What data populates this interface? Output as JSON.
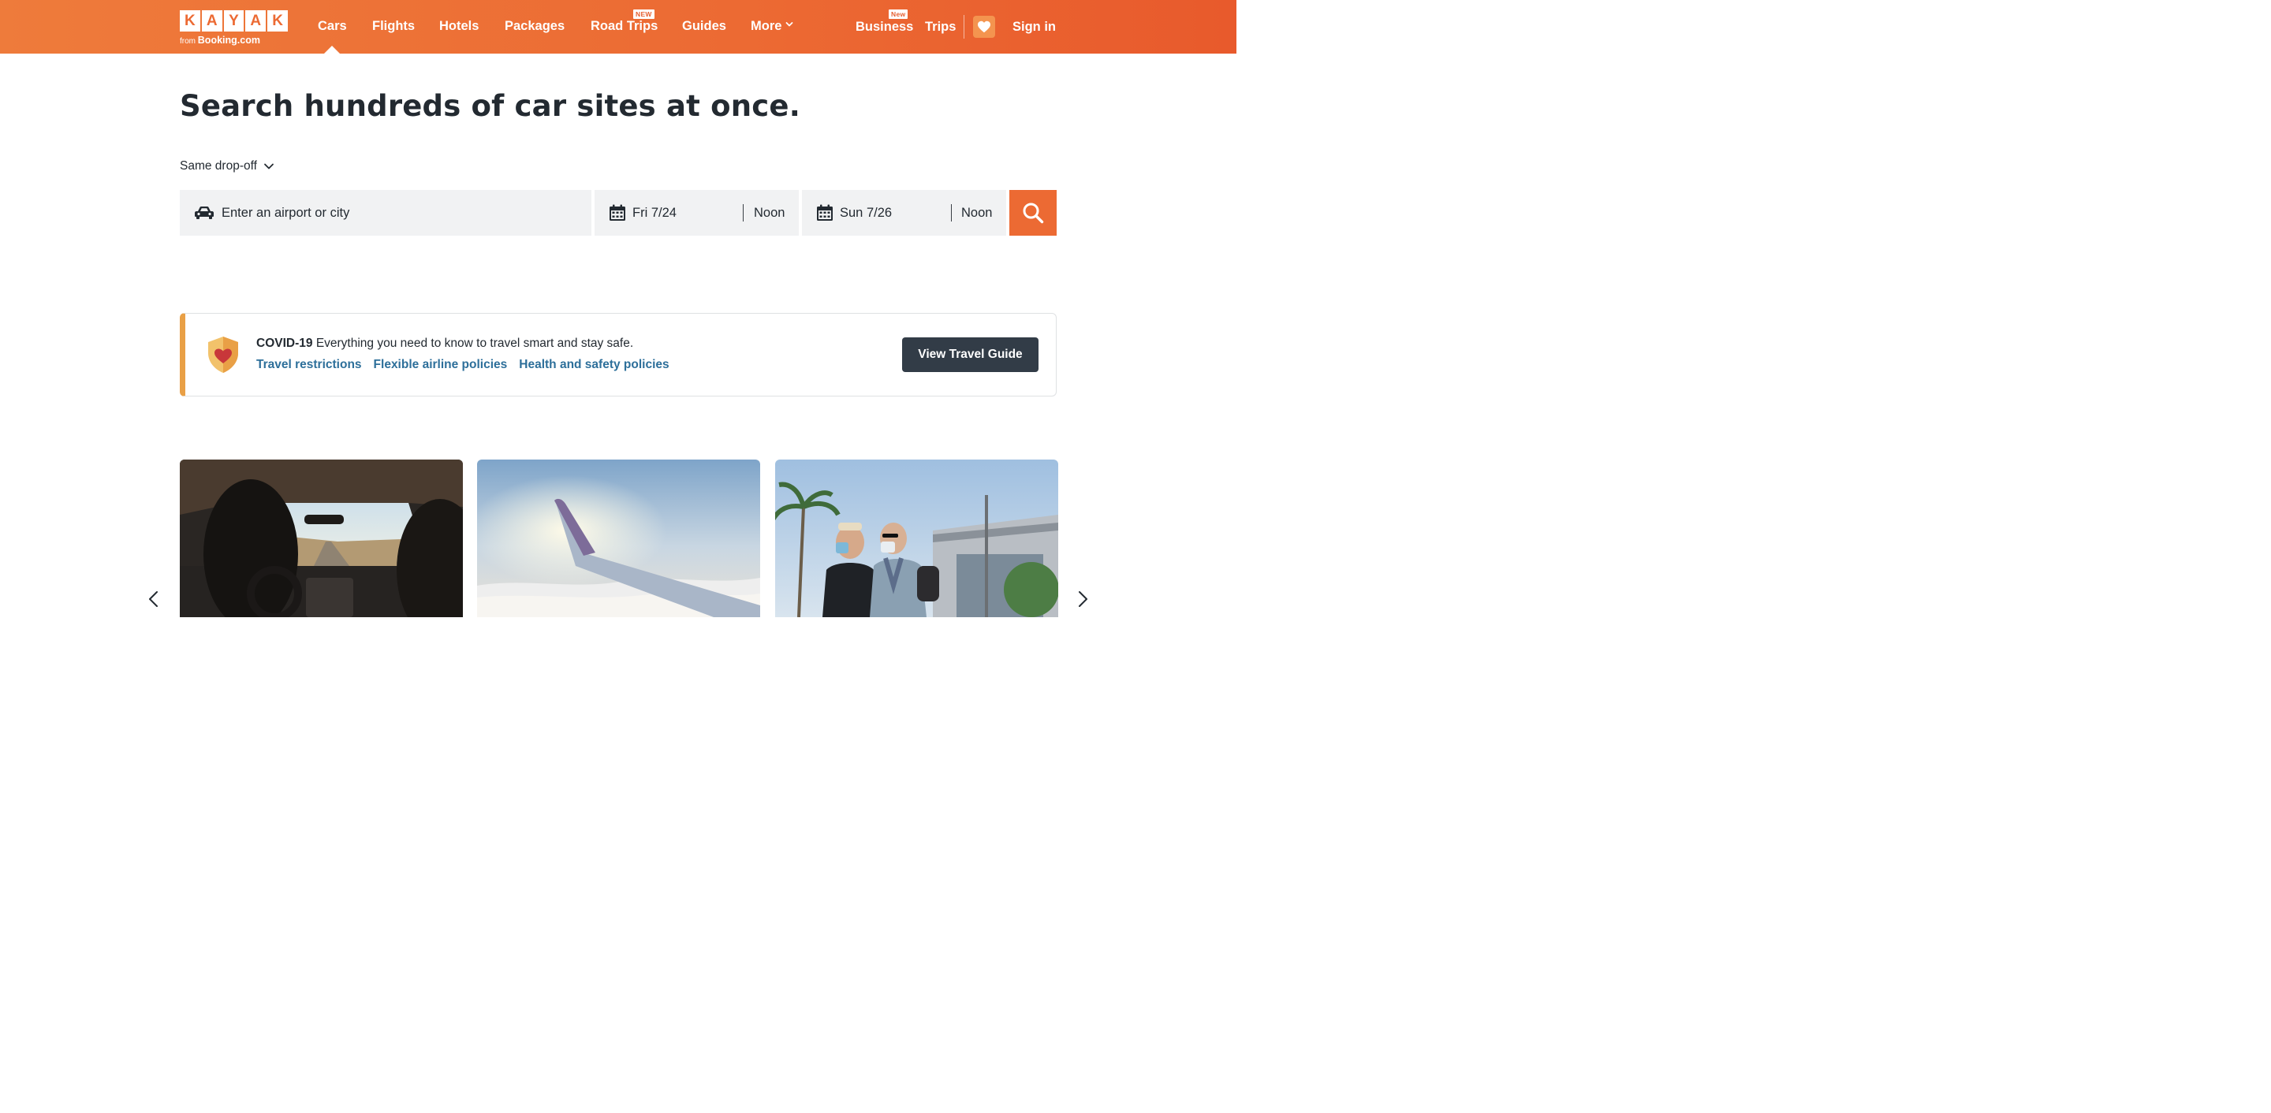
{
  "logo": {
    "letters": [
      "K",
      "A",
      "Y",
      "A",
      "K"
    ],
    "from_text": "from",
    "brand": "Booking.com"
  },
  "nav": {
    "items": [
      {
        "label": "Cars"
      },
      {
        "label": "Flights"
      },
      {
        "label": "Hotels"
      },
      {
        "label": "Packages"
      },
      {
        "label": "Road Trips",
        "badge": "NEW"
      },
      {
        "label": "Guides"
      },
      {
        "label": "More"
      }
    ],
    "right": {
      "business": "Business",
      "business_badge": "New",
      "trips": "Trips",
      "sign_in": "Sign in"
    }
  },
  "hero": {
    "title": "Search hundreds of car sites at once.",
    "dropoff_option": "Same drop-off"
  },
  "search": {
    "location_placeholder": "Enter an airport or city",
    "pickup_date": "Fri 7/24",
    "pickup_time": "Noon",
    "dropoff_date": "Sun 7/26",
    "dropoff_time": "Noon"
  },
  "covid": {
    "heading": "COVID-19",
    "message": "Everything you need to know to travel smart and stay safe.",
    "links": [
      "Travel restrictions",
      "Flexible airline policies",
      "Health and safety policies"
    ],
    "button": "View Travel Guide"
  },
  "colors": {
    "brand_orange": "#ec6a33",
    "dark": "#323c47",
    "link_blue": "#2d6f9a",
    "covid_accent": "#e9a046"
  },
  "icons": {
    "location": "car-icon",
    "date": "calendar-icon",
    "search": "search-icon",
    "saved": "heart-icon",
    "covid": "shield-heart-icon",
    "carousel_prev": "chevron-left-icon",
    "carousel_next": "chevron-right-icon"
  }
}
